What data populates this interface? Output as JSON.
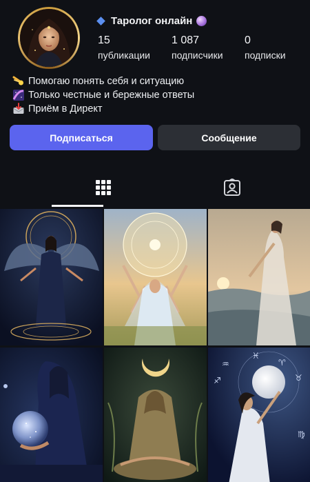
{
  "profile": {
    "name": "Таролог онлайн",
    "stats": [
      {
        "value": "15",
        "label": "публикации"
      },
      {
        "value": "1 087",
        "label": "подписчики"
      },
      {
        "value": "0",
        "label": "подписки"
      }
    ],
    "bio": [
      {
        "icon": "comet-icon",
        "text": "Помогаю понять себя и ситуацию"
      },
      {
        "icon": "galaxy-icon",
        "text": "Только честные и бережные ответы"
      },
      {
        "icon": "inbox-icon",
        "text": "Приём в Директ"
      }
    ]
  },
  "actions": {
    "follow_label": "Подписаться",
    "message_label": "Сообщение"
  },
  "tabs": [
    {
      "name": "grid-icon",
      "selected": true
    },
    {
      "name": "tagged-icon",
      "selected": false
    }
  ],
  "posts": [
    {
      "id": "post-1",
      "scene": "winged-angel-zodiac-wheel"
    },
    {
      "id": "post-2",
      "scene": "woman-raising-hands-zodiac-sun"
    },
    {
      "id": "post-3",
      "scene": "veiled-woman-sunset"
    },
    {
      "id": "post-4",
      "scene": "woman-holding-crystal-sphere"
    },
    {
      "id": "post-5",
      "scene": "meditating-woman-crescent-moon"
    },
    {
      "id": "post-6",
      "scene": "woman-reaching-moon-zodiac"
    }
  ],
  "colors": {
    "background": "#0f1116",
    "follow_button": "#5b64ee",
    "message_button": "#2c2f35"
  }
}
